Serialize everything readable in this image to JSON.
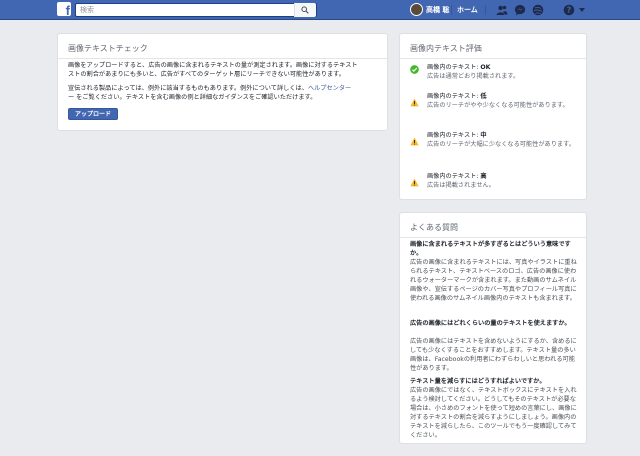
{
  "topbar": {
    "logo": "f",
    "search_placeholder": "検索",
    "user_name": "高橋 聡",
    "home_label": "ホーム",
    "icons": [
      "friend-requests-icon",
      "messages-icon",
      "notifications-icon",
      "help-icon",
      "account-menu-icon"
    ]
  },
  "image_check": {
    "title": "画像テキストチェック",
    "para1_line1": "画像をアップロードすると、広告の画像に含まれるテキストの量が測定されます。画像に対するテキスト",
    "para1_line2": "ストの割合があまりにも多いと、広告がすべてのターゲット層にリーチできない可能性があります。",
    "para2_line1_pre": "宣伝される製品によっては、例外に該当するものもあります。例外について詳しくは、",
    "para2_link": "ヘルプセンター",
    "para2_line2": "ー をご覧ください。テキストを含む画像の例と詳細なガイダンスをご確認いただけます。",
    "upload_button": "アップロード"
  },
  "rating": {
    "title": "画像内テキスト評価",
    "items": [
      {
        "label": "画像内のテキスト:",
        "level": "OK",
        "desc": "広告は通常どおり掲載されます。",
        "icon": "check-icon"
      },
      {
        "label": "画像内のテキスト:",
        "level": "低",
        "desc": "広告のリーチがやや少なくなる可能性があります。",
        "icon": "warning-icon"
      },
      {
        "label": "画像内のテキスト:",
        "level": "中",
        "desc": "広告のリーチが大幅に少なくなる可能性があります。",
        "icon": "warning-icon"
      },
      {
        "label": "画像内のテキスト:",
        "level": "高",
        "desc": "広告は掲載されません。",
        "icon": "warning-icon"
      }
    ],
    "colors": {
      "ok": "#42b72a",
      "warn": "#f7b928"
    }
  },
  "faq": {
    "title": "よくある質問",
    "items": [
      {
        "q": "画像に含まれるテキストが多すぎるとはどういう意味ですか。",
        "a": "広告の画像に含まれるテキストには、写真やイラストに重ねられるテキスト、テキストベースのロゴ、広告の画像に使われるウォーターマークが含まれます。また動画のサムネイル画像や、宣伝するページのカバー写真やプロフィール写真に使われる画像のサムネイル画像内のテキストも含まれます。"
      },
      {
        "q": "広告の画像にはどれくらいの量のテキストを使えますか。",
        "a": "広告の画像にはテキストを含めないようにするか、含めるにしても少なくすることをおすすめします。テキスト量の多い画像は、Facebookの利用者にわずらわしいと思われる可能性があります。"
      },
      {
        "q": "テキスト量を減らすにはどうすればよいですか。",
        "a": "広告の画像にではなく、テキストボックスにテキストを入れるよう検討してください。どうしてもそのテキストが必要な場合は、小さめのフォントを使って短めの言葉にし、画像に対するテキストの割合を減らすようにしましょう。画像内のテキストを減らしたら、このツールでもう一度確認してみてください。"
      }
    ]
  }
}
